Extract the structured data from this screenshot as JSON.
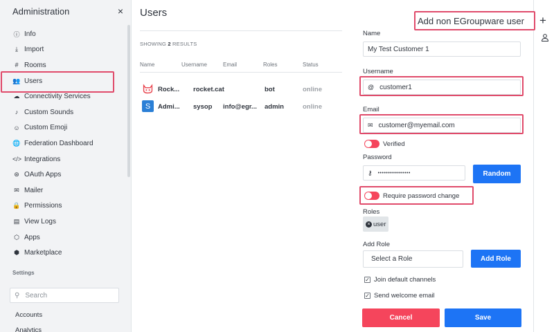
{
  "sidebar": {
    "title": "Administration",
    "close": "×",
    "items": [
      {
        "label": "Info",
        "icon": "ⓘ"
      },
      {
        "label": "Import",
        "icon": "⤓"
      },
      {
        "label": "Rooms",
        "icon": "#"
      },
      {
        "label": "Users",
        "icon": "👥"
      },
      {
        "label": "Connectivity Services",
        "icon": "☁"
      },
      {
        "label": "Custom Sounds",
        "icon": "♪"
      },
      {
        "label": "Custom Emoji",
        "icon": "☺"
      },
      {
        "label": "Federation Dashboard",
        "icon": "🌐"
      },
      {
        "label": "Integrations",
        "icon": "</>"
      },
      {
        "label": "OAuth Apps",
        "icon": "⊛"
      },
      {
        "label": "Mailer",
        "icon": "✉"
      },
      {
        "label": "Permissions",
        "icon": "🔒"
      },
      {
        "label": "View Logs",
        "icon": "▤"
      },
      {
        "label": "Apps",
        "icon": "⬡"
      },
      {
        "label": "Marketplace",
        "icon": "⬢"
      }
    ],
    "settings_heading": "Settings",
    "search_placeholder": "Search",
    "accounts": "Accounts",
    "analytics": "Analytics"
  },
  "main": {
    "title": "Users",
    "showing_prefix": "SHOWING",
    "showing_count": "2",
    "showing_suffix": "RESULTS",
    "columns": [
      "Name",
      "Username",
      "Email",
      "Roles",
      "Status"
    ],
    "rows": [
      {
        "name": "Rock...",
        "username": "rocket.cat",
        "email": "",
        "roles": "bot",
        "status": "online"
      },
      {
        "name": "Admi...",
        "username": "sysop",
        "email": "info@egr...",
        "roles": "admin",
        "status": "online",
        "avatar_letter": "S"
      }
    ]
  },
  "panel": {
    "title": "Add non EGroupware user",
    "add": "+",
    "name_label": "Name",
    "name_value": "My Test Customer 1",
    "username_label": "Username",
    "username_prefix": "@",
    "username_value": "customer1",
    "email_label": "Email",
    "email_value": "customer@myemail.com",
    "verified_label": "Verified",
    "password_label": "Password",
    "password_value": "••••••••••••••••",
    "random_label": "Random",
    "require_pw_label": "Require password change",
    "roles_label": "Roles",
    "role_chip": "user",
    "add_role_label": "Add Role",
    "select_role_placeholder": "Select a Role",
    "add_role_button": "Add Role",
    "join_default_label": "Join default channels",
    "send_welcome_label": "Send welcome email",
    "cancel_label": "Cancel",
    "save_label": "Save"
  },
  "colors": {
    "accent_blue": "#1d74f5",
    "danger_red": "#f5455c",
    "highlight": "#e04a6a"
  }
}
